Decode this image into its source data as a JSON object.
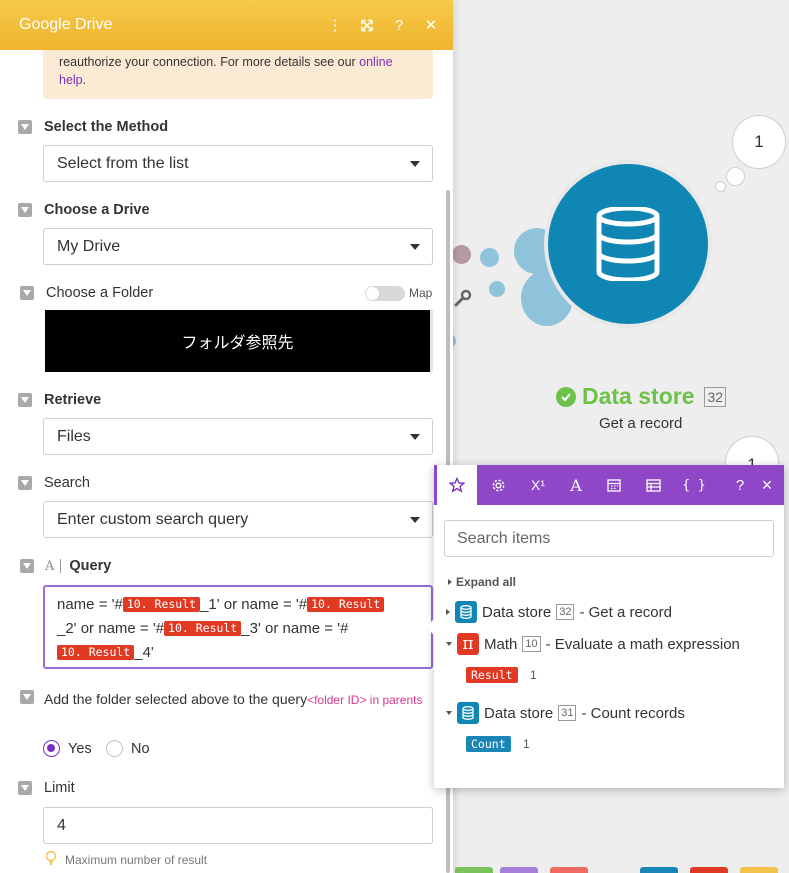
{
  "panel": {
    "title": "Google Drive",
    "warning_text": "reauthorize your connection. For more details see our ",
    "warning_link": "online help",
    "warning_end": "."
  },
  "fields": {
    "method": {
      "label": "Select the Method",
      "value": "Select from the list"
    },
    "drive": {
      "label": "Choose a Drive",
      "value": "My Drive"
    },
    "folder": {
      "label": "Choose a Folder",
      "map_label": "Map",
      "value": "フォルダ参照先"
    },
    "retrieve": {
      "label": "Retrieve",
      "value": "Files"
    },
    "search": {
      "label": "Search",
      "value": "Enter custom search query"
    },
    "query": {
      "label": "Query",
      "pill": "10. Result",
      "t1": "name = '#",
      "t2": "_1' or name = '#",
      "t3": "_2' or name = '#",
      "t4": "_3' or name = '#",
      "t5": "_4'"
    },
    "add_folder": {
      "label": "Add the folder selected above to the query",
      "hint": "<folder ID> in parents",
      "yes": "Yes",
      "no": "No"
    },
    "limit": {
      "label": "Limit",
      "value": "4",
      "help": "Maximum number of result"
    }
  },
  "canvas": {
    "bubble_count_top": "1",
    "bubble_count_second": "1",
    "module_title": "Data store",
    "module_number": "32",
    "module_subtitle": "Get a record"
  },
  "mapper": {
    "search_placeholder": "Search items",
    "expand_all": "Expand all",
    "tabs": [
      "star-tab",
      "gear-tab",
      "superscript-tab",
      "text-tab",
      "calendar-tab",
      "table-tab",
      "braces-tab"
    ],
    "tab_labels": {
      "x1": "X¹",
      "text": "A",
      "braces": "{ }",
      "help": "?",
      "close": "×"
    },
    "items": [
      {
        "name": "Data store",
        "num": "32",
        "desc": "- Get a record"
      },
      {
        "name": "Math",
        "num": "10",
        "desc": "- Evaluate a math expression",
        "chip": "Result",
        "chip_value": "1"
      },
      {
        "name": "Data store",
        "num": "31",
        "desc": "- Count records",
        "chip": "Count",
        "chip_value": "1"
      }
    ]
  },
  "colors": {
    "header_yellow": "#f2bc38",
    "accent_purple": "#8e47c6",
    "datastore_blue": "#0f86b3",
    "success_green": "#6cc24a",
    "pill_red": "#e03a24"
  }
}
